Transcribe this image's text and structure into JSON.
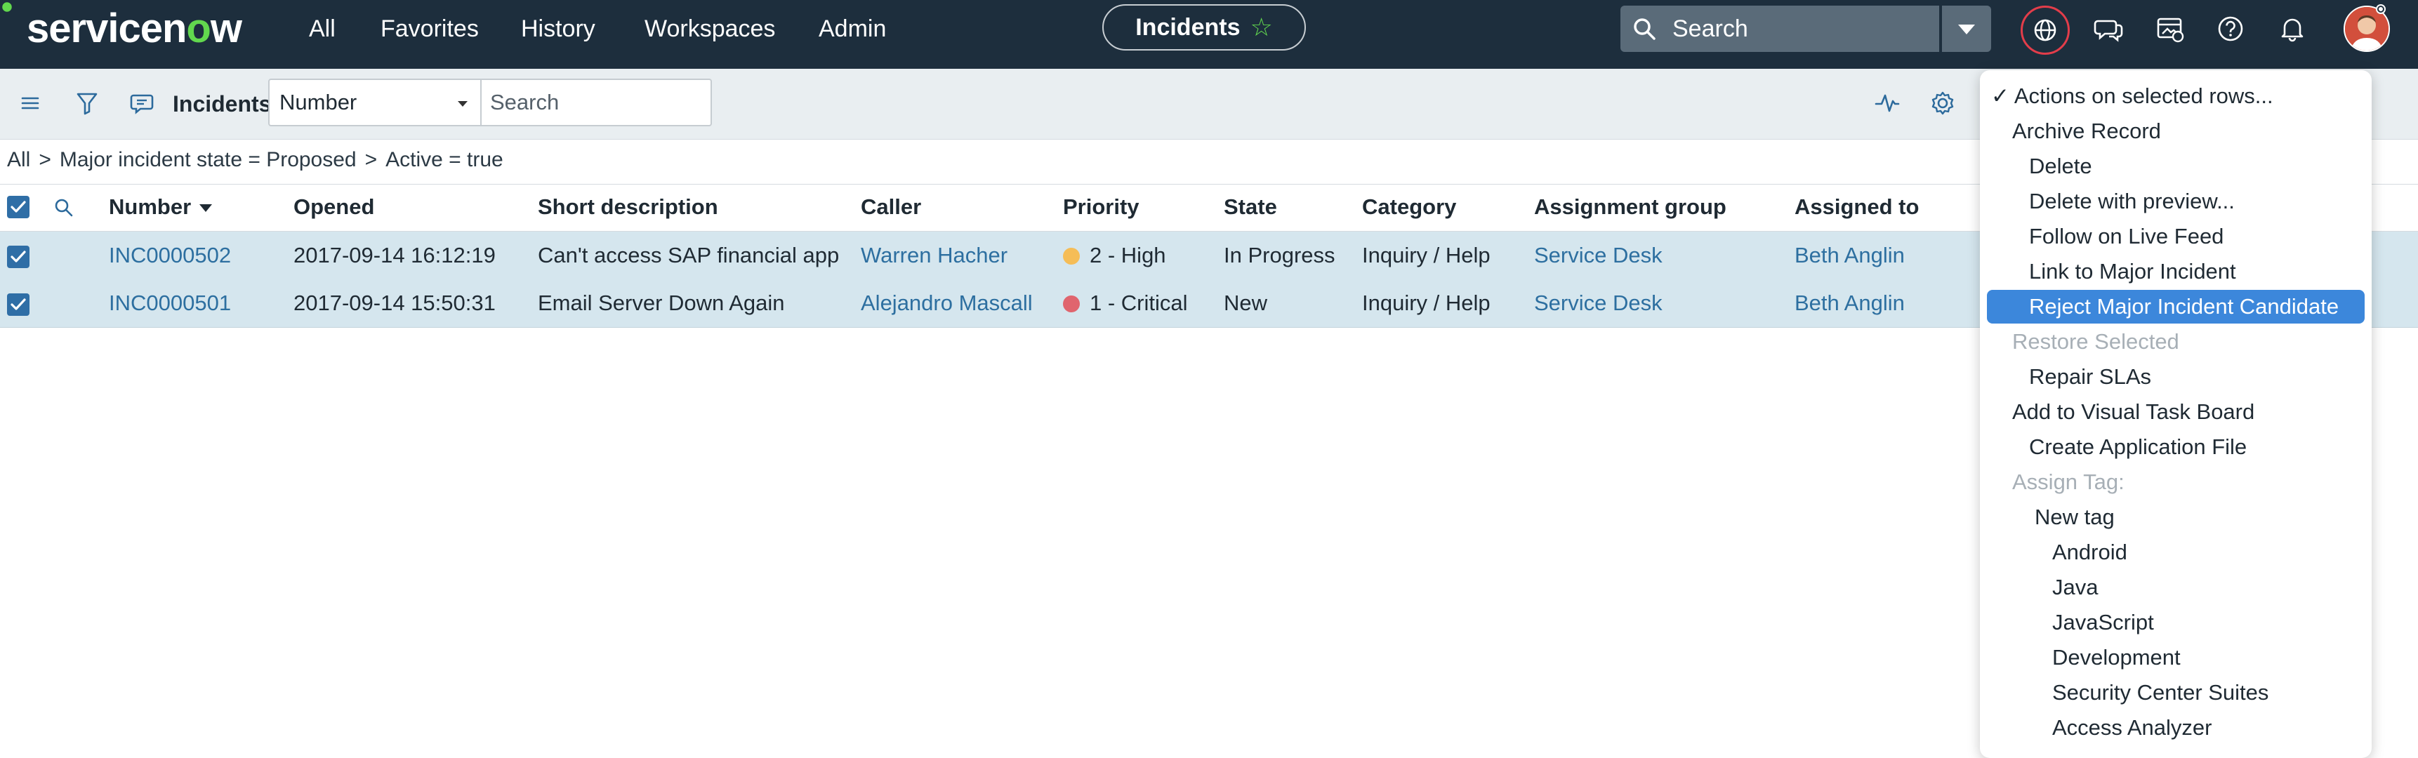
{
  "brand": {
    "logo_prefix": "servicen",
    "logo_o": "o",
    "logo_suffix": "w"
  },
  "nav": {
    "links": [
      "All",
      "Favorites",
      "History",
      "Workspaces",
      "Admin"
    ],
    "context_pill": "Incidents",
    "search_placeholder": "Search"
  },
  "toolbar": {
    "list_title": "Incidents",
    "field_select_value": "Number",
    "search_placeholder": "Search"
  },
  "breadcrumb": [
    "All",
    ">",
    "Major incident state = Proposed",
    ">",
    "Active = true"
  ],
  "table": {
    "columns": [
      "Number",
      "Opened",
      "Short description",
      "Caller",
      "Priority",
      "State",
      "Category",
      "Assignment group",
      "Assigned to"
    ],
    "sort_column": "Number",
    "rows": [
      {
        "number": "INC0000502",
        "opened": "2017-09-14 16:12:19",
        "short_description": "Can't access SAP financial app",
        "caller": "Warren Hacher",
        "priority": "2 - High",
        "priority_color": "#f5bd57",
        "state": "In Progress",
        "category": "Inquiry / Help",
        "assignment_group": "Service Desk",
        "assigned_to": "Beth Anglin",
        "selected": true
      },
      {
        "number": "INC0000501",
        "opened": "2017-09-14 15:50:31",
        "short_description": "Email Server Down Again",
        "caller": "Alejandro Mascall",
        "priority": "1 - Critical",
        "priority_color": "#e0656e",
        "state": "New",
        "category": "Inquiry / Help",
        "assignment_group": "Service Desk",
        "assigned_to": "Beth Anglin",
        "selected": true
      }
    ]
  },
  "context_menu": {
    "items": [
      {
        "label": "✓ Actions on selected rows...",
        "state": "header"
      },
      {
        "label": "Archive Record",
        "state": "normal"
      },
      {
        "label": "Delete",
        "state": "normal"
      },
      {
        "label": "Delete with preview...",
        "state": "normal"
      },
      {
        "label": "Follow on Live Feed",
        "state": "normal"
      },
      {
        "label": "Link to Major Incident",
        "state": "normal"
      },
      {
        "label": "Reject Major Incident Candidate",
        "state": "highlighted"
      },
      {
        "label": "Restore Selected",
        "state": "disabled"
      },
      {
        "label": "Repair SLAs",
        "state": "normal"
      },
      {
        "label": "Add to Visual Task Board",
        "state": "normal"
      },
      {
        "label": "Create Application File",
        "state": "normal"
      },
      {
        "label": "Assign Tag:",
        "state": "disabled"
      },
      {
        "label": "New tag",
        "state": "normal"
      },
      {
        "label": "Android",
        "state": "normal"
      },
      {
        "label": "Java",
        "state": "normal"
      },
      {
        "label": "JavaScript",
        "state": "normal"
      },
      {
        "label": "Development",
        "state": "normal"
      },
      {
        "label": "Security Center Suites",
        "state": "normal"
      },
      {
        "label": "Access Analyzer",
        "state": "normal"
      }
    ]
  },
  "icons": {
    "nav": [
      "globe-icon",
      "chat-icon",
      "media-icon",
      "help-icon",
      "bell-icon"
    ],
    "toolbar": [
      "hamburger-icon",
      "filter-icon",
      "comment-icon",
      "activity-icon",
      "gear-icon"
    ]
  },
  "colors": {
    "nav_bg": "#1d2e3d",
    "brand_green": "#62d84e",
    "row_selected": "#d5e6ee",
    "link": "#2d6fa0",
    "menu_highlight": "#3c87db"
  }
}
